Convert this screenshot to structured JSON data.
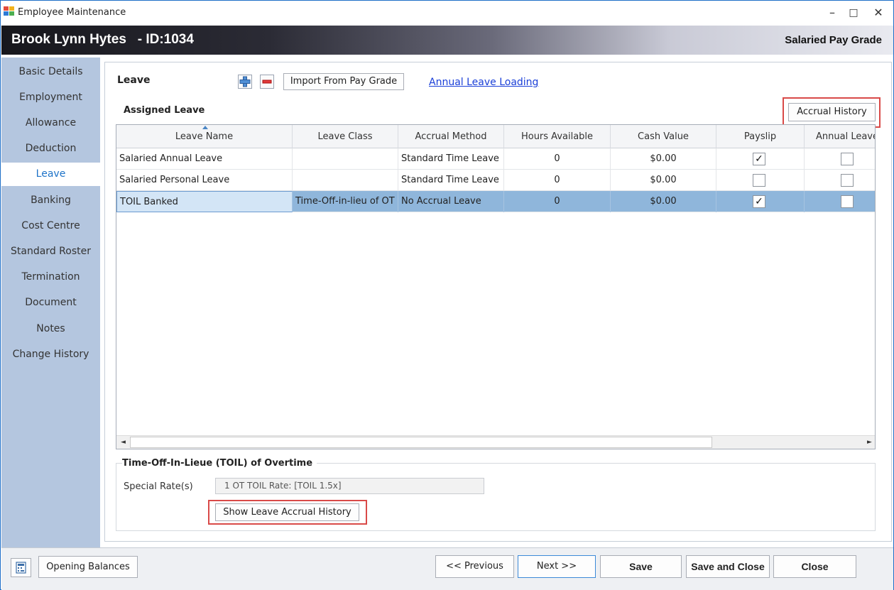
{
  "window": {
    "title": "Employee Maintenance",
    "minimize": "–",
    "maximize": "□",
    "close": "✕"
  },
  "header": {
    "employee": "Brook Lynn Hytes   - ID:1034",
    "pay_grade": "Salaried Pay Grade"
  },
  "sidebar": {
    "items": [
      {
        "label": "Basic Details"
      },
      {
        "label": "Employment"
      },
      {
        "label": "Allowance"
      },
      {
        "label": "Deduction"
      },
      {
        "label": "Leave",
        "active": true
      },
      {
        "label": "Banking"
      },
      {
        "label": "Cost Centre"
      },
      {
        "label": "Standard Roster"
      },
      {
        "label": "Termination"
      },
      {
        "label": "Document"
      },
      {
        "label": "Notes"
      },
      {
        "label": "Change History"
      }
    ]
  },
  "leave": {
    "heading": "Leave",
    "add_icon": "plus-icon",
    "remove_icon": "minus-icon",
    "import_button": "Import From Pay Grade",
    "annual_loading_link": "Annual Leave Loading",
    "assigned_heading": "Assigned Leave",
    "accrual_history_button": "Accrual History"
  },
  "grid": {
    "columns": [
      "Leave Name",
      "Leave Class",
      "Accrual Method",
      "Hours Available",
      "Cash Value",
      "Payslip",
      "Annual Leave"
    ],
    "rows": [
      {
        "name": "Salaried Annual Leave",
        "class": "",
        "method": "Standard Time Leave",
        "hours": "0",
        "cash": "$0.00",
        "payslip": true,
        "annual": false
      },
      {
        "name": "Salaried Personal Leave",
        "class": "",
        "method": "Standard Time Leave",
        "hours": "0",
        "cash": "$0.00",
        "payslip": false,
        "annual": false
      },
      {
        "name": "TOIL Banked",
        "class": "Time-Off-in-lieu of OT",
        "method": "No Accrual Leave",
        "hours": "0",
        "cash": "$0.00",
        "payslip": true,
        "annual": false,
        "selected": true
      }
    ],
    "scroll_left": "◄",
    "scroll_right": "►"
  },
  "toil": {
    "heading": "Time-Off-In-Lieue (TOIL) of Overtime",
    "special_rates_label": "Special Rate(s)",
    "special_rates_value": "1 OT TOIL Rate: [TOIL 1.5x]",
    "show_history_button": "Show Leave Accrual History"
  },
  "footer": {
    "calculator_icon": "calculator-icon",
    "opening_balances": "Opening Balances",
    "previous": "<< Previous",
    "next": "Next >>",
    "save": "Save",
    "save_and_close": "Save and Close",
    "close": "Close"
  },
  "colors": {
    "accent": "#1e73c8",
    "sidebar": "#b4c6df",
    "selected_row": "#8fb6db",
    "highlight": "#d94a48",
    "link": "#1a3fd8"
  }
}
